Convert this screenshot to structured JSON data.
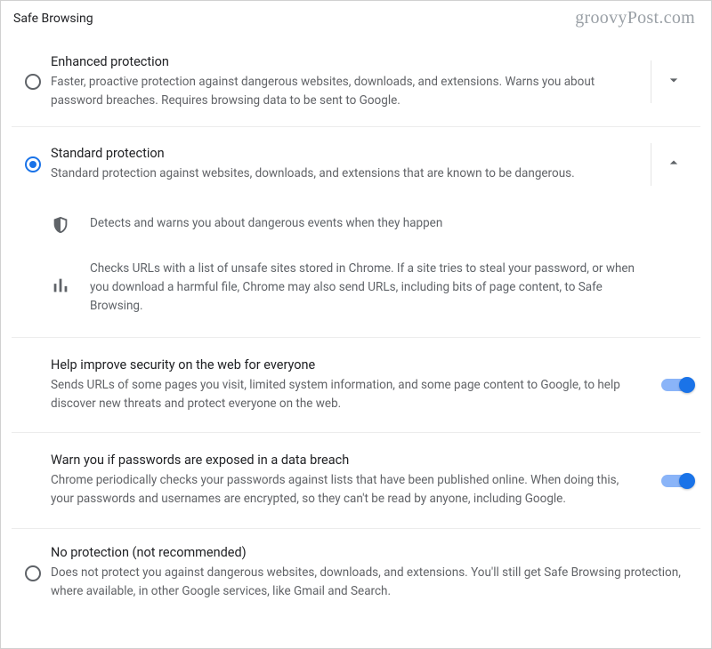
{
  "sectionTitle": "Safe Browsing",
  "watermark": "groovyPost.com",
  "options": {
    "enhanced": {
      "title": "Enhanced protection",
      "desc": "Faster, proactive protection against dangerous websites, downloads, and extensions. Warns you about password breaches. Requires browsing data to be sent to Google.",
      "selected": false,
      "expanded": false
    },
    "standard": {
      "title": "Standard protection",
      "desc": "Standard protection against websites, downloads, and extensions that are known to be dangerous.",
      "selected": true,
      "expanded": true,
      "features": {
        "detects": "Detects and warns you about dangerous events when they happen",
        "checks": "Checks URLs with a list of unsafe sites stored in Chrome. If a site tries to steal your password, or when you download a harmful file, Chrome may also send URLs, including bits of page content, to Safe Browsing."
      },
      "toggles": {
        "helpImprove": {
          "title": "Help improve security on the web for everyone",
          "desc": "Sends URLs of some pages you visit, limited system information, and some page content to Google, to help discover new threats and protect everyone on the web.",
          "on": true
        },
        "warnPasswords": {
          "title": "Warn you if passwords are exposed in a data breach",
          "desc": "Chrome periodically checks your passwords against lists that have been published online. When doing this, your passwords and usernames are encrypted, so they can't be read by anyone, including Google.",
          "on": true
        }
      }
    },
    "none": {
      "title": "No protection (not recommended)",
      "desc": "Does not protect you against dangerous websites, downloads, and extensions. You'll still get Safe Browsing protection, where available, in other Google services, like Gmail and Search.",
      "selected": false
    }
  }
}
